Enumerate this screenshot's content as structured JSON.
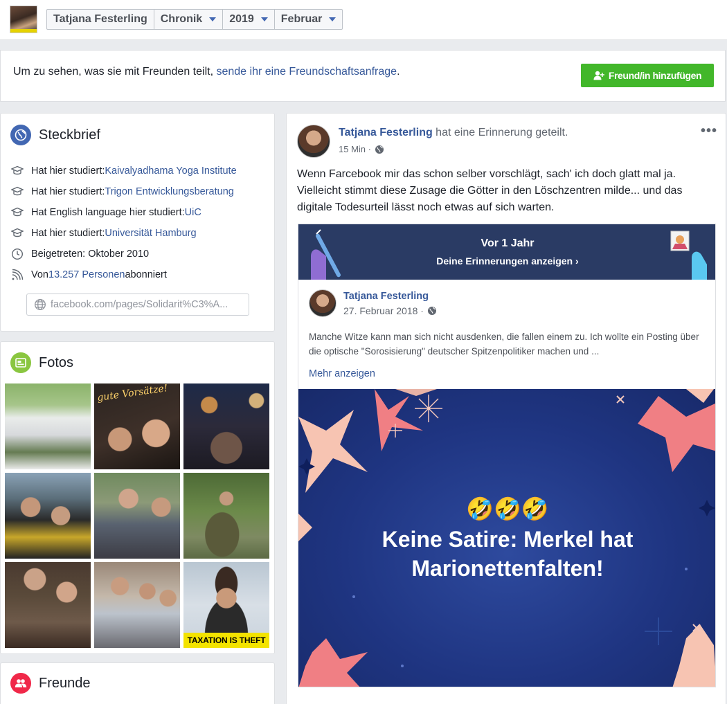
{
  "topbar": {
    "profile_name": "Tatjana Festerling",
    "view": "Chronik",
    "year": "2019",
    "month": "Februar"
  },
  "friend_banner": {
    "message": "Um zu sehen, was sie mit Freunden teilt,",
    "link": "sende ihr eine Freundschaftsanfrage",
    "period": ".",
    "button_label": "Freund/in hinzufügen",
    "button_color": "#42b72a"
  },
  "intro": {
    "title": "Steckbrief",
    "items": [
      {
        "icon": "graduation-cap-icon",
        "prefix": "Hat hier studiert: ",
        "link": "Kaivalyadhama Yoga Institute",
        "suffix": ""
      },
      {
        "icon": "graduation-cap-icon",
        "prefix": "Hat hier studiert: ",
        "link": "Trigon Entwicklungsberatung",
        "suffix": ""
      },
      {
        "icon": "graduation-cap-icon",
        "prefix": "Hat English language hier studiert: ",
        "link": "UiC",
        "suffix": ""
      },
      {
        "icon": "graduation-cap-icon",
        "prefix": "Hat hier studiert: ",
        "link": "Universität Hamburg",
        "suffix": ""
      },
      {
        "icon": "clock-icon",
        "prefix": "Beigetreten: Oktober 2010",
        "link": "",
        "suffix": ""
      },
      {
        "icon": "rss-icon",
        "prefix": "Von ",
        "link": "13.257 Personen",
        "suffix": " abonniert"
      }
    ],
    "url": "facebook.com/pages/Solidarit%C3%A..."
  },
  "photos": {
    "title": "Fotos",
    "handwritten_caption": "gute Vorsätze!",
    "last_photo_caption": "TAXATION IS THEFT"
  },
  "friends": {
    "title": "Freunde"
  },
  "post": {
    "author": "Tatjana Festerling",
    "action": " hat eine Erinnerung geteilt.",
    "time": "15 Min",
    "menu": "•••",
    "text": "Wenn Farcebook mir das schon selber vorschlägt, sach' ich doch glatt mal ja. Vielleicht stimmt diese Zusage die Götter in den Löschzentren milde... und das digitale Todesurteil lässt noch etwas auf sich warten.",
    "memory": {
      "title": "Vor 1 Jahr",
      "cta": "Deine Erinnerungen anzeigen",
      "author": "Tatjana Festerling",
      "date": "27. Februar 2018",
      "text": "Manche Witze kann man sich nicht ausdenken, die fallen einem zu. Ich wollte ein Posting über die optische \"Sorosisierung\" deutscher Spitzenpolitiker machen und ...",
      "more": "Mehr anzeigen",
      "image_emoji": "🤣🤣🤣",
      "image_line1": "Keine Satire: Merkel hat",
      "image_line2": "Marionettenfalten!"
    }
  }
}
